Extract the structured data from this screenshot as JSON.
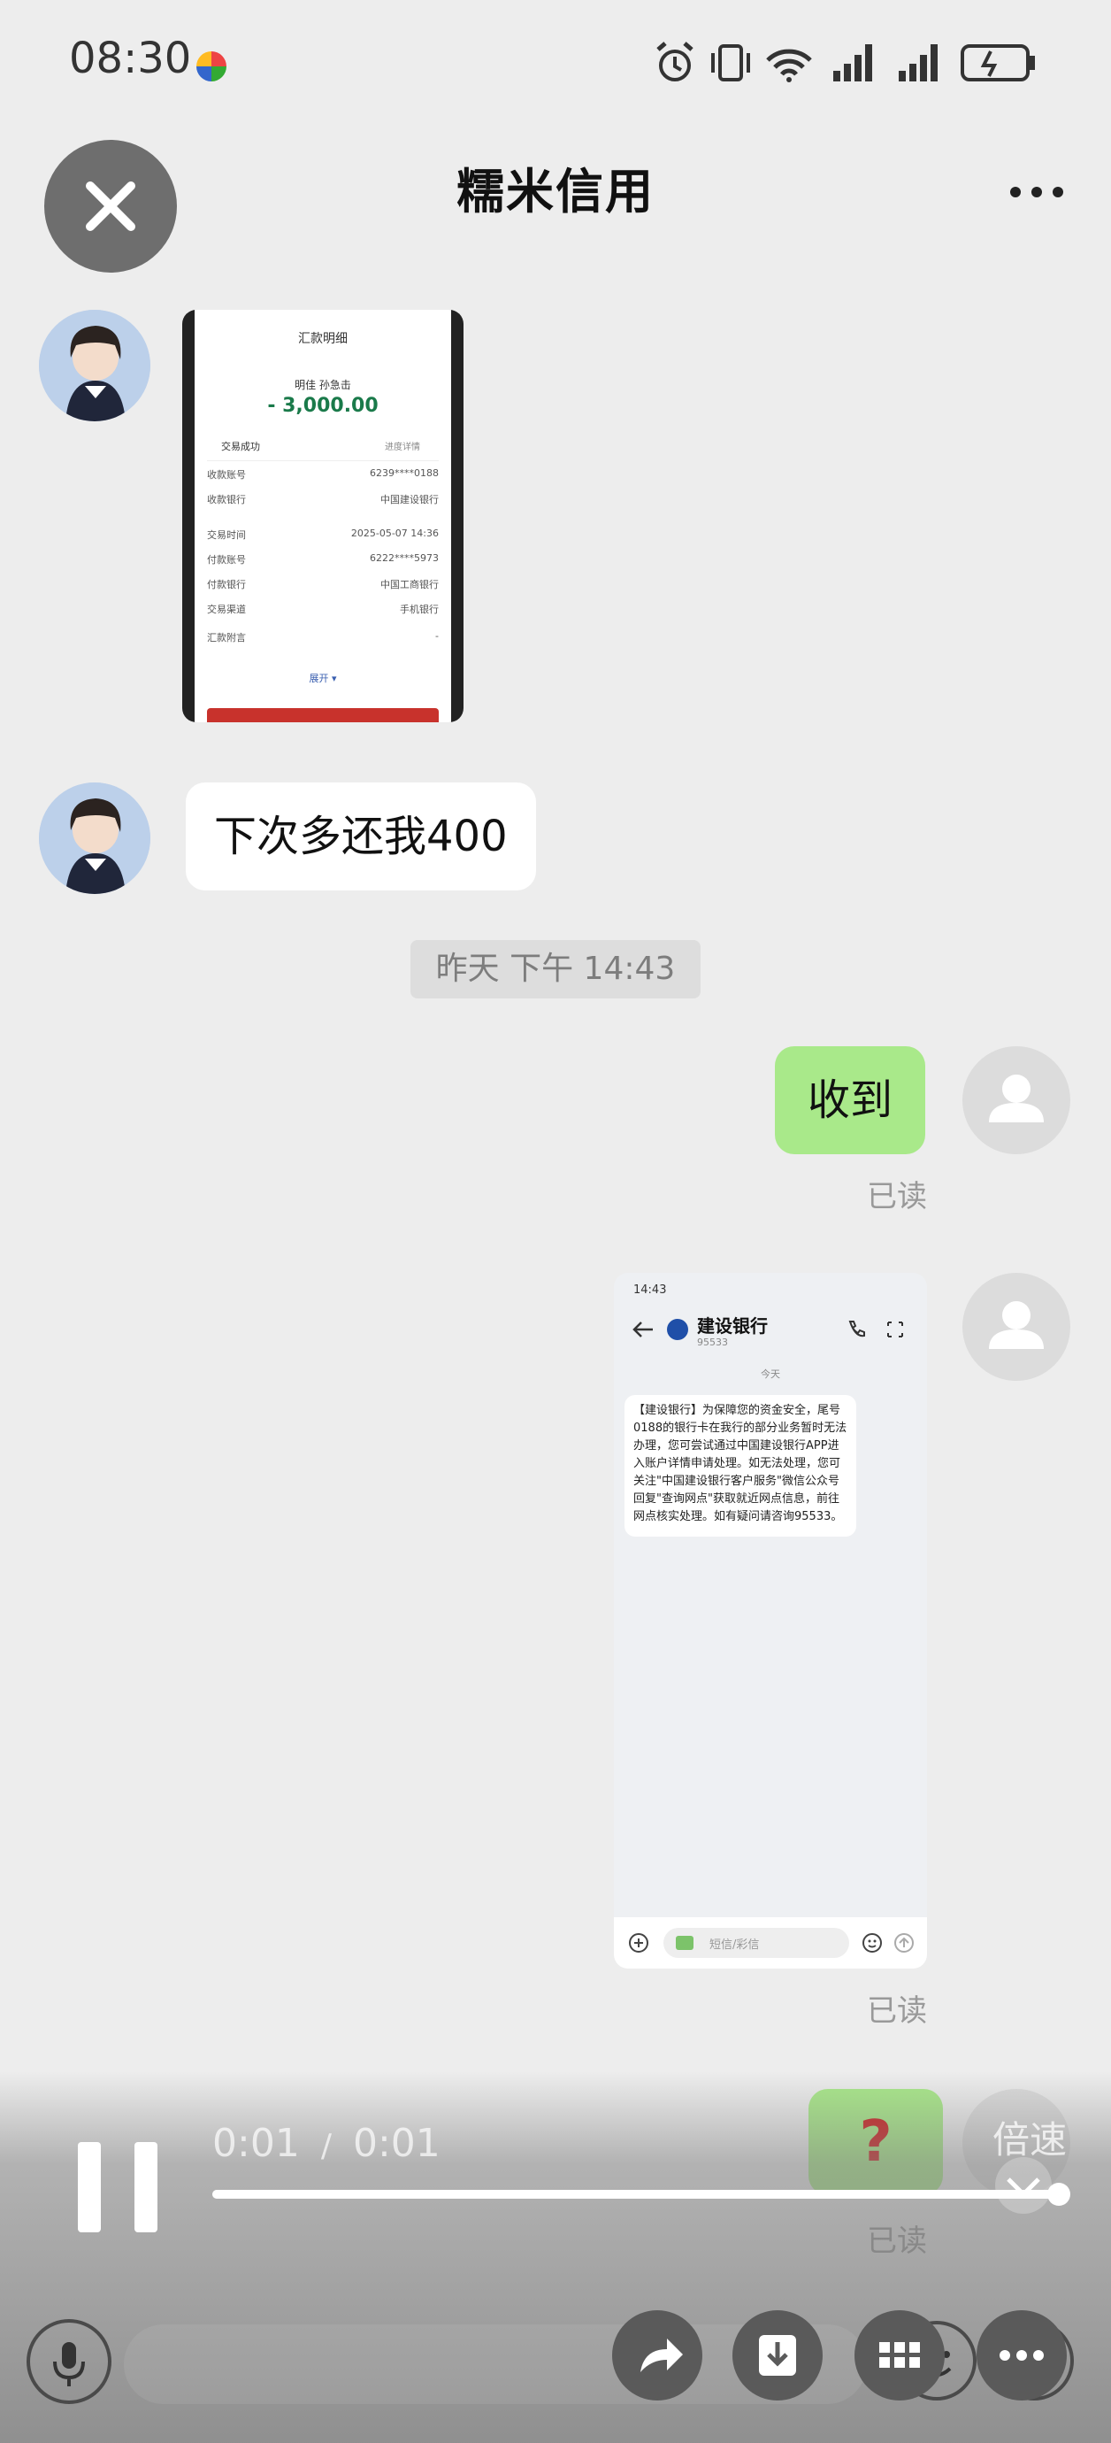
{
  "status_bar": {
    "time": "08:30"
  },
  "header": {
    "title": "糯米信用"
  },
  "messages": {
    "bank_detail": {
      "tab_title": "汇款明细",
      "payee_name": "明佳 孙急击",
      "amount": "- 3,000.00",
      "status": "交易成功",
      "details_link": "进度详情",
      "rows": [
        {
          "label": "收款账号",
          "value": "6239****0188"
        },
        {
          "label": "收款银行",
          "value": "中国建设银行"
        },
        {
          "label": "交易时间",
          "value": "2025-05-07 14:36"
        },
        {
          "label": "付款账号",
          "value": "6222****5973"
        },
        {
          "label": "付款银行",
          "value": "中国工商银行"
        },
        {
          "label": "交易渠道",
          "value": "手机银行"
        },
        {
          "label": "汇款附言",
          "value": "-"
        }
      ],
      "expand": "展开 ▾"
    },
    "text_left": "下次多还我400",
    "timestamp": "昨天 下午 14:43",
    "text_right": "收到",
    "read_1": "已读",
    "sms_shot": {
      "time": "14:43",
      "sender": "建设银行",
      "number": "95533",
      "day": "今天",
      "body": "【建设银行】为保障您的资金安全，尾号0188的银行卡在我行的部分业务暂时无法办理，您可尝试通过中国建设银行APP进入账户详情申请处理。如无法处理，您可关注\"中国建设银行客户服务\"微信公众号回复\"查询网点\"获取就近网点信息，前往网点核实处理。如有疑问请咨询95533。",
      "input_placeholder": "短信/彩信"
    },
    "read_2": "已读",
    "question": "?",
    "read_3": "已读"
  },
  "player": {
    "elapsed": "0:01",
    "separator": "/",
    "duration": "0:01",
    "speed_label": "倍速",
    "progress": 1.0
  }
}
